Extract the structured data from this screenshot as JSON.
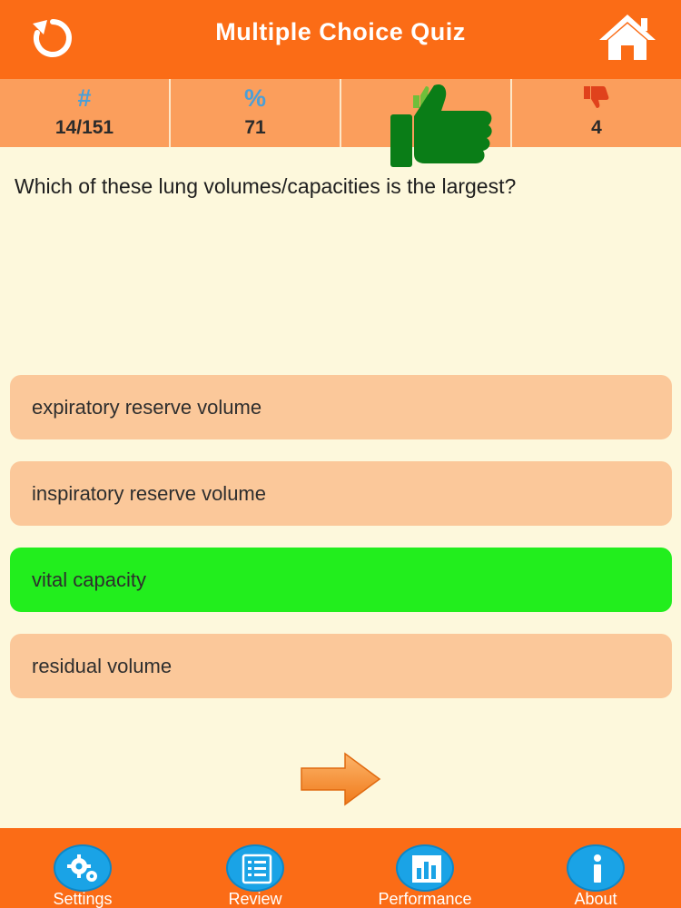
{
  "header": {
    "title": "Multiple Choice Quiz"
  },
  "stats": [
    {
      "symbol": "#",
      "value": "14/151"
    },
    {
      "symbol": "%",
      "value": "71"
    },
    {
      "symbol": "",
      "value": ""
    },
    {
      "symbol": "",
      "value": "4"
    }
  ],
  "question": "Which of these lung volumes/capacities is the largest?",
  "answers": [
    {
      "label": "expiratory reserve volume",
      "state": "default"
    },
    {
      "label": "inspiratory reserve volume",
      "state": "default"
    },
    {
      "label": "vital capacity",
      "state": "correct"
    },
    {
      "label": "residual volume",
      "state": "default"
    }
  ],
  "tabs": [
    {
      "label": "Settings",
      "icon": "gears-icon"
    },
    {
      "label": "Review",
      "icon": "review-list-icon"
    },
    {
      "label": "Performance",
      "icon": "bar-chart-icon"
    },
    {
      "label": "About",
      "icon": "info-icon"
    }
  ],
  "colors": {
    "header": "#fb6c16",
    "stats_bar": "#fb9e5c",
    "background": "#fdf8dc",
    "answer": "#fbc89a",
    "correct": "#22ee1d",
    "tab_icon": "#1aa3e6"
  }
}
